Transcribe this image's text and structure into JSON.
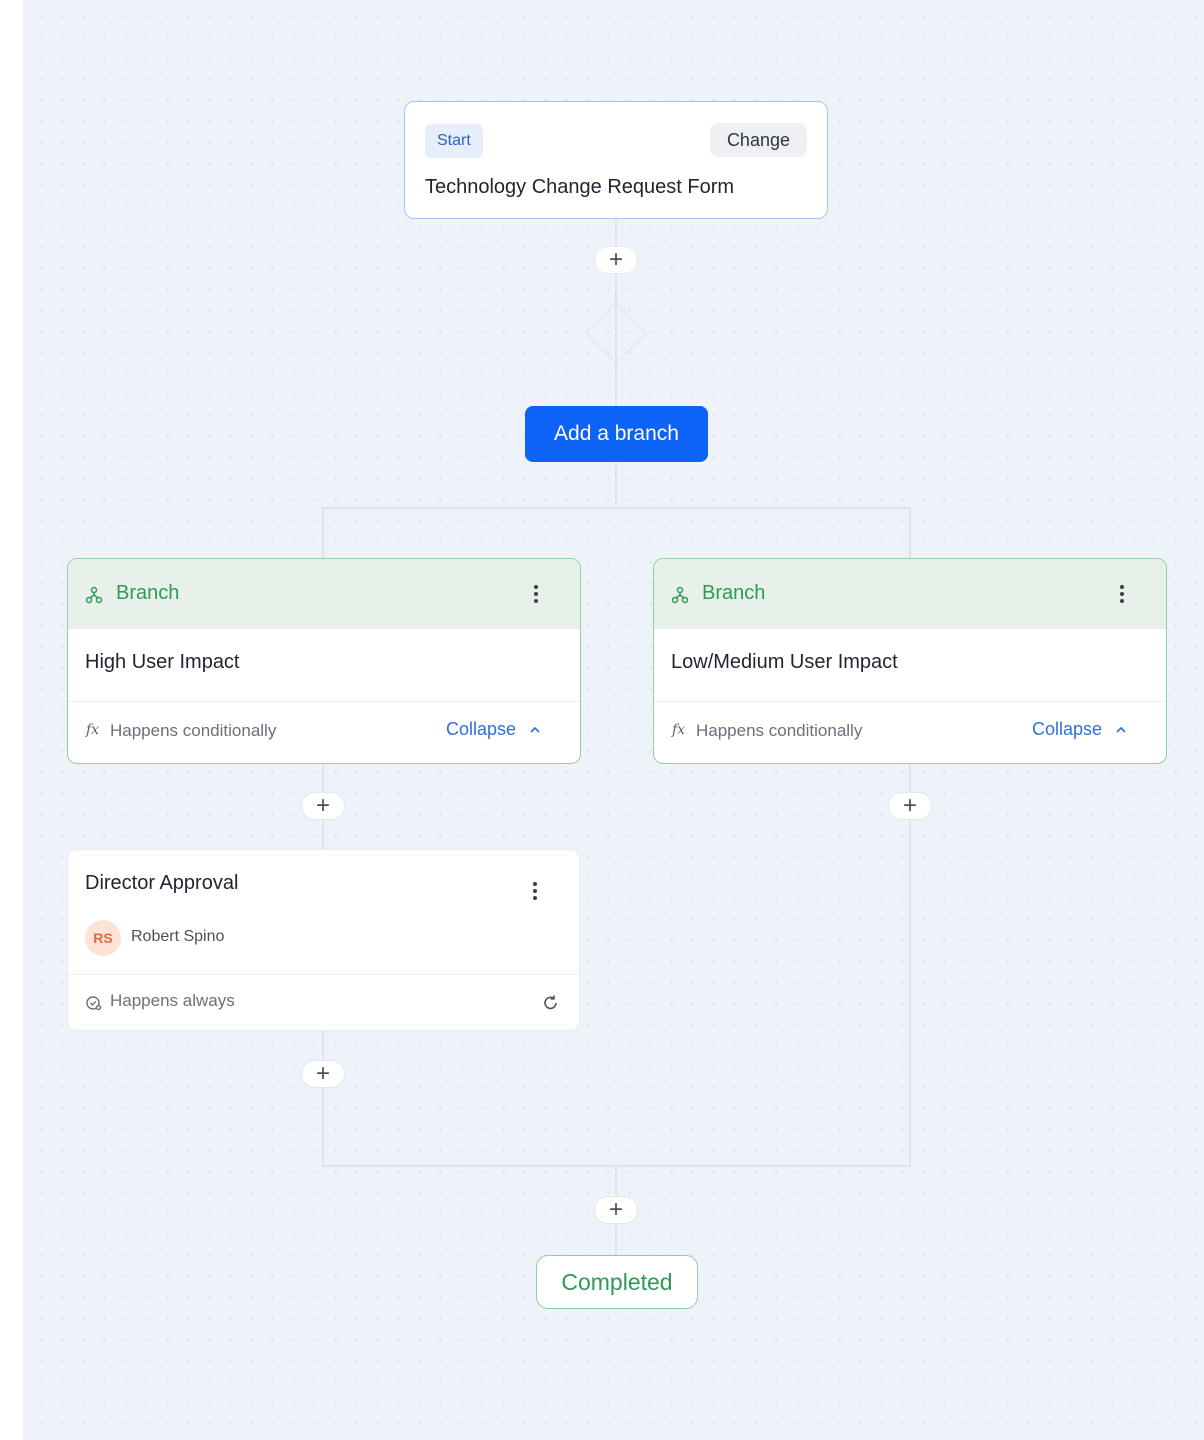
{
  "start_card": {
    "badge": "Start",
    "change_label": "Change",
    "title": "Technology Change Request Form"
  },
  "add_branch_label": "Add a branch",
  "plus_label": "+",
  "branches": [
    {
      "header": "Branch",
      "title": "High User Impact",
      "condition": "Happens conditionally",
      "condition_icon": "fx-icon",
      "collapse_label": "Collapse"
    },
    {
      "header": "Branch",
      "title": "Low/Medium User Impact",
      "condition": "Happens conditionally",
      "condition_icon": "fx-icon",
      "collapse_label": "Collapse"
    }
  ],
  "fx_glyph": "fx",
  "approval": {
    "title": "Director Approval",
    "assignee_initials": "RS",
    "assignee_name": "Robert Spino",
    "condition": "Happens always"
  },
  "completed_label": "Completed",
  "colors": {
    "primary": "#0d63f5",
    "branch_green": "#2f9a55",
    "branch_header_bg": "#e7f1ea",
    "link_blue": "#2f6fd6",
    "canvas_bg": "#eef2f9"
  }
}
